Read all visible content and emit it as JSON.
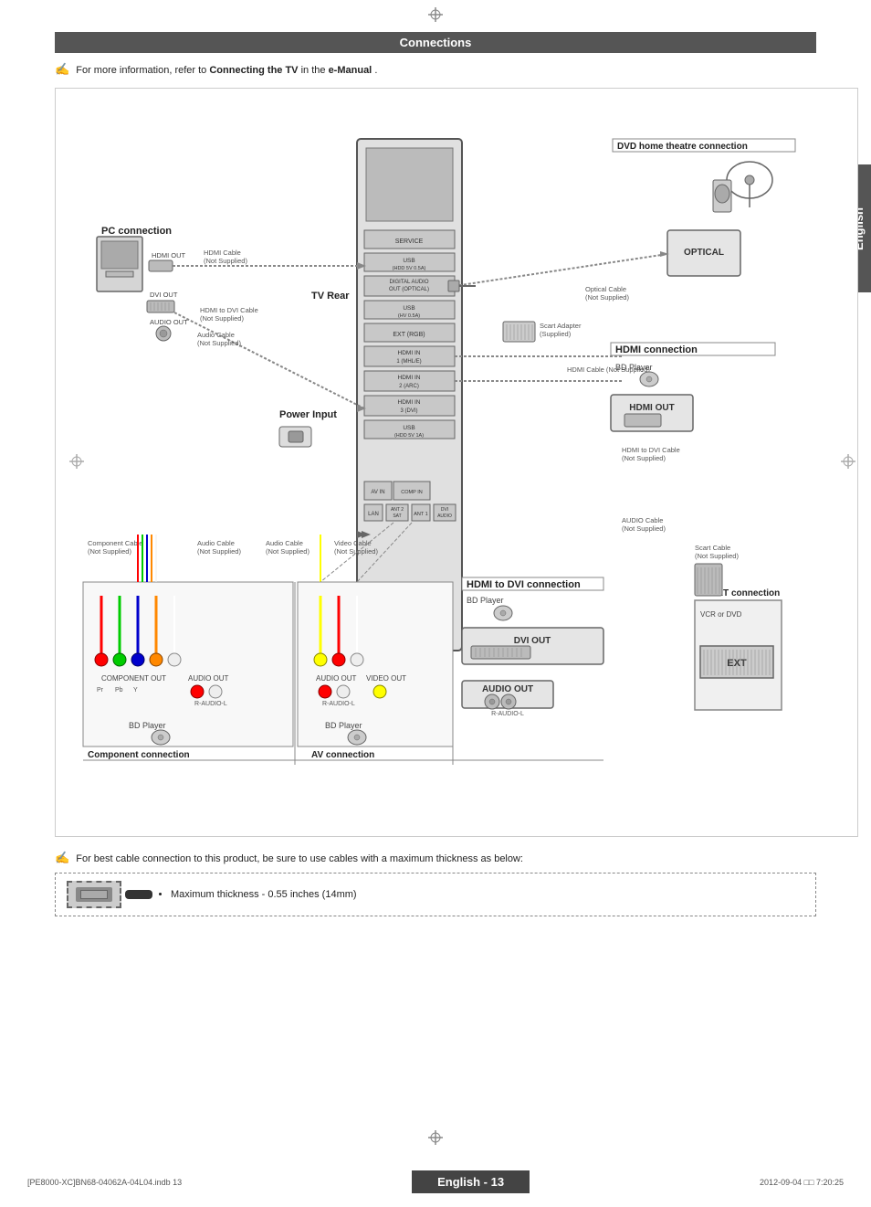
{
  "page": {
    "side_tab": "English",
    "header": "Connections",
    "note1": "For more information, refer to ",
    "note1_bold1": "Connecting the TV",
    "note1_mid": " in the ",
    "note1_bold2": "e-Manual",
    "note1_end": ".",
    "note2": "For best cable connection to  this product, be sure to use cables with a maximum thickness as below:",
    "cable_note": "Maximum thickness - 0.55 inches (14mm)",
    "page_number": "English - 13",
    "footer_left": "[PE8000-XC]BN68-04062A-04L04.indb   13",
    "footer_right": "2012-09-04   □□ 7:20:25"
  },
  "connections": {
    "pc_connection": "PC connection",
    "tv_rear": "TV Rear",
    "power_input": "Power Input",
    "hdmi_connection": "HDMI connection",
    "hdmi_dvi_connection": "HDMI to DVI connection",
    "component_connection": "Component connection",
    "av_connection": "AV connection",
    "scart_connection": "SCART connection",
    "dvd_home": "DVD home theatre connection"
  },
  "ports": {
    "service": "SERVICE",
    "usb1": "USB (HDD 5V 0.5A)",
    "digital_audio": "DIGITAL AUDIO OUT (OPTICAL)",
    "usb2": "USB (HV 0.5A)",
    "ext": "EXT (RGB)",
    "hdmi1": "HDMI IN 1 (MHL/E)",
    "hdmi2": "HDMI IN 2 (ARC)",
    "hdmi3": "HDMI IN 3 (DVI)",
    "usb3": "USB (HDD 5V 1A)",
    "av_in": "AV IN",
    "component_in": "COMPONENT IN",
    "lan": "LAN",
    "ant2_sat": "ANT 2 IN (SATELLITE)",
    "ant1": "ANT 1 IN",
    "dvi_audio": "DVI AUDIO IN"
  },
  "cables": {
    "hdmi_cable": "HDMI Cable\n(Not Supplied)",
    "hdmi_dvi_cable": "HDMI to DVI Cable\n(Not Supplied)",
    "audio_cable": "Audio Cable\n(Not Supplied)",
    "optical_cable": "Optical Cable\n(Not Supplied)",
    "scart_adapter": "Scart Adapter\n(Supplied)",
    "hdmi_cable2": "HDMI Cable (Not Supplied)",
    "hdmi_dvi_cable2": "HDMI to DVI Cable\n(Not Supplied)",
    "scart_cable": "Scart Cable\n(Not Supplied)",
    "audio_cable2": "AUDIO Cable\n(Not Supplied)",
    "component_cable": "Component Cable\n(Not Supplied)",
    "video_cable": "Video Cable\n(Not Supplied)",
    "audio_cable3": "Audio Cable\n(Not Supplied)",
    "audio_cable4": "Audio Cable\n(Not Supplied)"
  },
  "labels": {
    "hdmi_out": "HDMI OUT",
    "dvi_out": "DVI OUT",
    "audio_out": "AUDIO OUT",
    "bd_player1": "BD Player",
    "bd_player2": "BD Player",
    "bd_player3": "BD Player",
    "optical": "OPTICAL",
    "hdmi_out2": "HDMI OUT",
    "dvi_out2": "DVI OUT",
    "audio_out2": "AUDIO OUT",
    "r_audio_l": "R-AUDIO-L",
    "r_audio_l2": "R-AUDIO-L",
    "vcr_dvd": "VCR or DVD",
    "ext_label": "EXT",
    "component_out": "COMPONENT OUT",
    "audio_out3": "AUDIO OUT",
    "audio_out4": "AUDIO OUT",
    "video_out": "VIDEO OUT",
    "pr": "Pr",
    "pb": "Pb",
    "y": "Y"
  }
}
